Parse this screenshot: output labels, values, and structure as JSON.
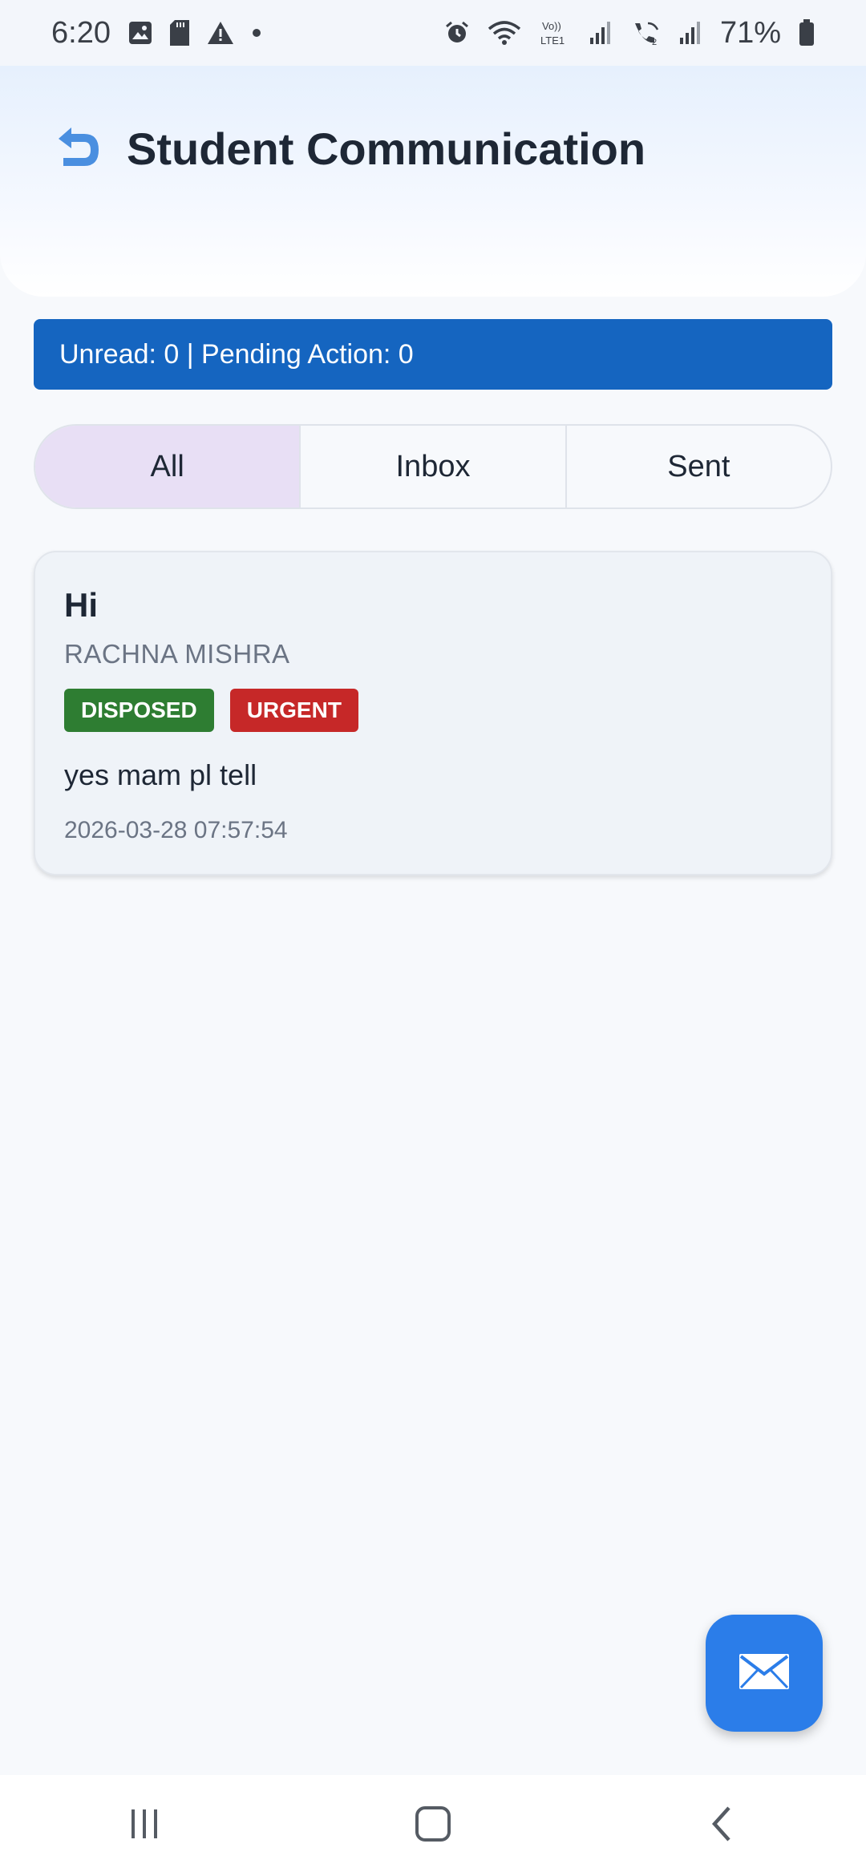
{
  "status_bar": {
    "time": "6:20",
    "battery": "71%",
    "left_icons": [
      "image-icon",
      "sd-card-icon",
      "warning-icon",
      "dot-icon"
    ],
    "right_icons": [
      "alarm-icon",
      "wifi-icon",
      "volte-icon",
      "signal-icon",
      "wifi-calling-icon",
      "signal-icon",
      "battery-icon"
    ]
  },
  "header": {
    "title": "Student Communication",
    "back_icon": "undo-arrow-icon"
  },
  "summary": {
    "text": "Unread: 0 | Pending Action: 0"
  },
  "tabs": [
    {
      "label": "All",
      "active": true
    },
    {
      "label": "Inbox",
      "active": false
    },
    {
      "label": "Sent",
      "active": false
    }
  ],
  "messages": [
    {
      "title": "Hi",
      "sender": "RACHNA MISHRA",
      "badges": [
        "DISPOSED",
        "URGENT"
      ],
      "body": "yes mam pl tell",
      "timestamp": "2026-03-28 07:57:54"
    }
  ],
  "fab": {
    "icon": "mail-icon"
  },
  "colors": {
    "primary": "#1565c0",
    "fab": "#2b7de9",
    "tab_active": "#e8dff5",
    "disposed": "#2e7d32",
    "urgent": "#c62828"
  },
  "nav_bar": {
    "icons": [
      "recents-icon",
      "home-icon",
      "back-icon"
    ]
  }
}
